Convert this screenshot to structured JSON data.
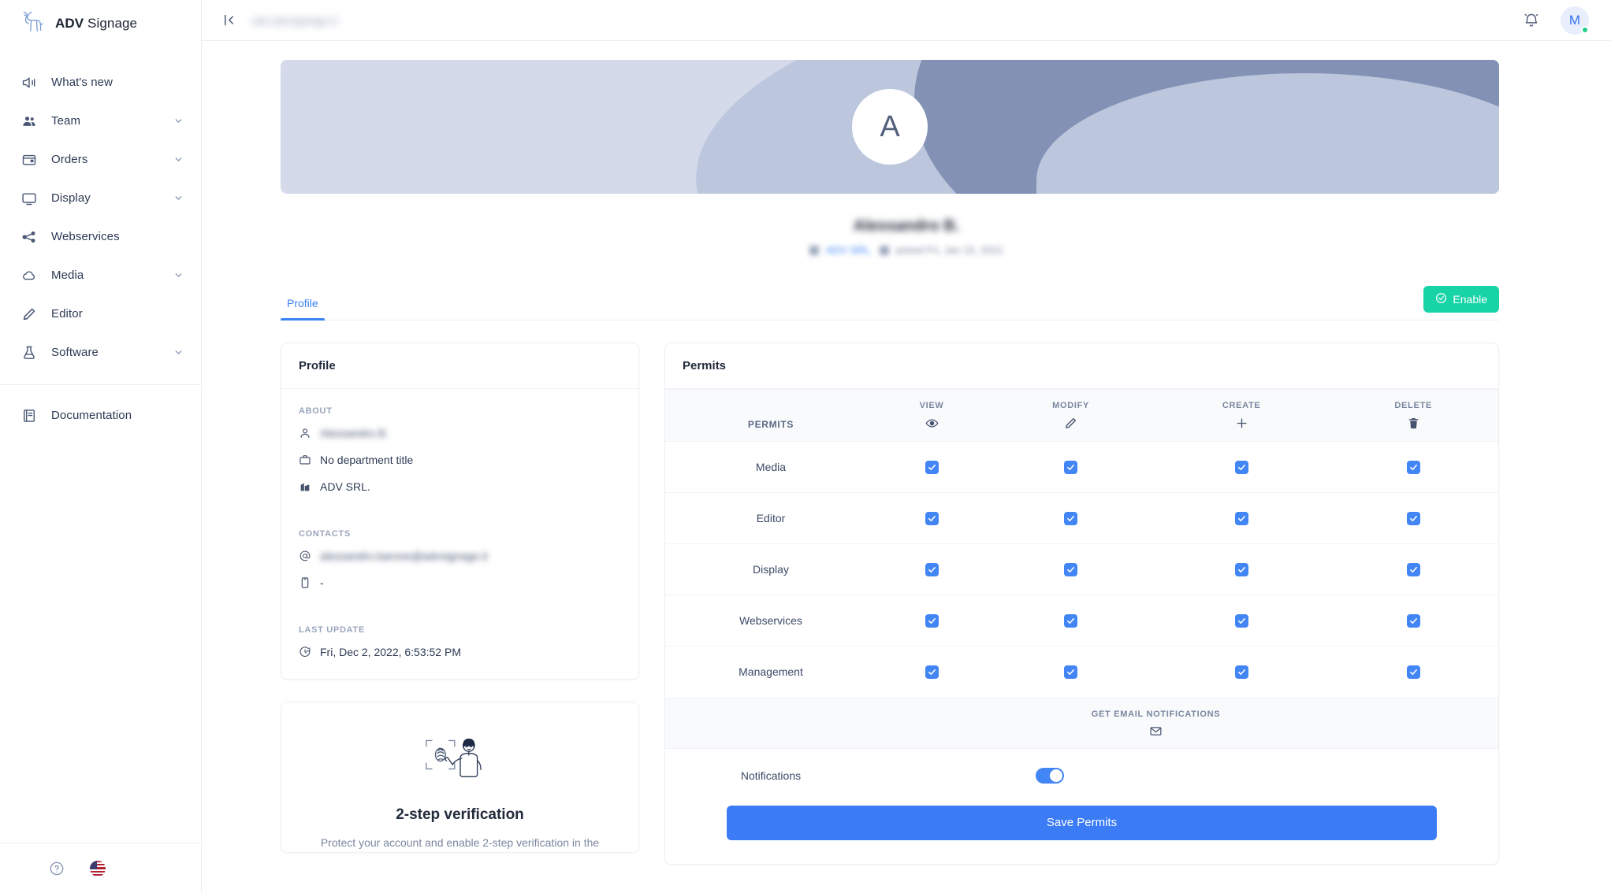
{
  "brand": {
    "name_bold": "ADV",
    "name_rest": " Signage",
    "logo_icon": "deer-logo-icon"
  },
  "sidebar": {
    "items": [
      {
        "label": "What's new",
        "icon": "megaphone-icon",
        "expandable": false
      },
      {
        "label": "Team",
        "icon": "users-icon",
        "expandable": true
      },
      {
        "label": "Orders",
        "icon": "wallet-icon",
        "expandable": true
      },
      {
        "label": "Display",
        "icon": "monitor-icon",
        "expandable": true
      },
      {
        "label": "Webservices",
        "icon": "share-nodes-icon",
        "expandable": false
      },
      {
        "label": "Media",
        "icon": "cloud-icon",
        "expandable": true
      },
      {
        "label": "Editor",
        "icon": "pencil-icon",
        "expandable": false
      },
      {
        "label": "Software",
        "icon": "flask-icon",
        "expandable": true
      }
    ],
    "documentation": {
      "label": "Documentation",
      "icon": "book-icon"
    },
    "footer": {
      "help_icon": "question-circle-icon",
      "language_icon": "us-flag-icon"
    }
  },
  "topbar": {
    "collapse_icon": "collapse-panel-icon",
    "breadcrumb": "adv.advsignage.it",
    "notifications_icon": "bell-icon",
    "avatar_initial": "M",
    "status": "online"
  },
  "profile_header": {
    "avatar_initial": "A",
    "name": "Alessandro B.",
    "company": "ADV SRL.",
    "joined": "joined Fri, Jan 15, 2021",
    "company_icon": "building-icon",
    "joined_icon": "calendar-icon"
  },
  "tabs": [
    {
      "label": "Profile",
      "active": true
    }
  ],
  "enable_button": {
    "label": "Enable",
    "icon": "check-circle-icon"
  },
  "profile_card": {
    "title": "Profile",
    "about_label": "ABOUT",
    "about": [
      {
        "icon": "user-icon",
        "value": "Alessandro B.",
        "redacted": true
      },
      {
        "icon": "briefcase-icon",
        "value": "No department title",
        "redacted": false
      },
      {
        "icon": "building-icon",
        "value": "ADV SRL.",
        "redacted": false
      }
    ],
    "contacts_label": "CONTACTS",
    "contacts": [
      {
        "icon": "at-icon",
        "value": "alessandro.barone@advsignage.it",
        "redacted": true
      },
      {
        "icon": "phone-icon",
        "value": "-",
        "redacted": false
      }
    ],
    "last_update_label": "LAST UPDATE",
    "last_update": {
      "icon": "clock-icon",
      "value": "Fri, Dec 2, 2022, 6:53:52 PM"
    }
  },
  "two_factor_card": {
    "illustration_icon": "fingerprint-scan-person-icon",
    "title": "2-step verification",
    "description": "Protect your account and enable 2-step verification in the"
  },
  "permits_card": {
    "title": "Permits",
    "row_header": "PERMITS",
    "columns": [
      {
        "label": "VIEW",
        "icon": "eye-icon"
      },
      {
        "label": "MODIFY",
        "icon": "pencil-icon"
      },
      {
        "label": "CREATE",
        "icon": "plus-icon"
      },
      {
        "label": "DELETE",
        "icon": "trash-icon"
      }
    ],
    "rows": [
      {
        "name": "Media",
        "view": true,
        "modify": true,
        "create": true,
        "delete": true
      },
      {
        "name": "Editor",
        "view": true,
        "modify": true,
        "create": true,
        "delete": true
      },
      {
        "name": "Display",
        "view": true,
        "modify": true,
        "create": true,
        "delete": true
      },
      {
        "name": "Webservices",
        "view": true,
        "modify": true,
        "create": true,
        "delete": true
      },
      {
        "name": "Management",
        "view": true,
        "modify": true,
        "create": true,
        "delete": true
      }
    ],
    "email_section": {
      "label": "GET EMAIL NOTIFICATIONS",
      "icon": "envelope-icon"
    },
    "notifications": {
      "label": "Notifications",
      "enabled": true
    },
    "save_button": "Save Permits"
  },
  "colors": {
    "accent_blue": "#3b7bf6",
    "checkbox_blue": "#4285f4",
    "enable_green": "#17d4a7",
    "status_green": "#21cf88",
    "text_dark": "#222b3c",
    "text_muted": "#7a879f"
  }
}
